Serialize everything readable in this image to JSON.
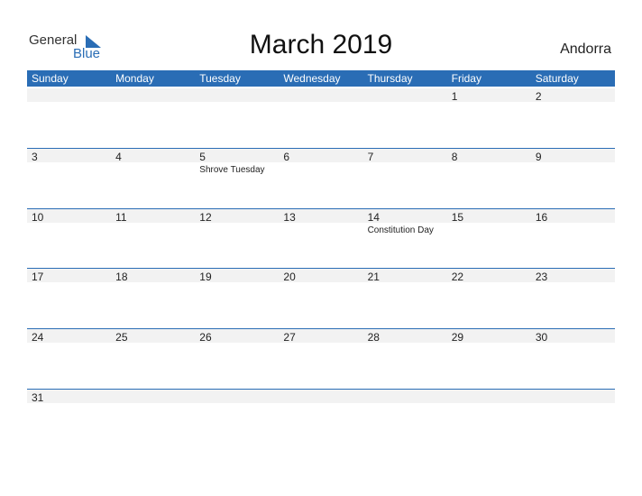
{
  "logo": {
    "general": "General",
    "blue": "Blue"
  },
  "title": "March 2019",
  "country": "Andorra",
  "colors": {
    "accent": "#2a6db5",
    "band": "#f2f2f2"
  },
  "weekdays": [
    "Sunday",
    "Monday",
    "Tuesday",
    "Wednesday",
    "Thursday",
    "Friday",
    "Saturday"
  ],
  "weeks": [
    [
      {
        "n": ""
      },
      {
        "n": ""
      },
      {
        "n": ""
      },
      {
        "n": ""
      },
      {
        "n": ""
      },
      {
        "n": "1"
      },
      {
        "n": "2"
      }
    ],
    [
      {
        "n": "3"
      },
      {
        "n": "4"
      },
      {
        "n": "5",
        "event": "Shrove Tuesday"
      },
      {
        "n": "6"
      },
      {
        "n": "7"
      },
      {
        "n": "8"
      },
      {
        "n": "9"
      }
    ],
    [
      {
        "n": "10"
      },
      {
        "n": "11"
      },
      {
        "n": "12"
      },
      {
        "n": "13"
      },
      {
        "n": "14",
        "event": "Constitution Day"
      },
      {
        "n": "15"
      },
      {
        "n": "16"
      }
    ],
    [
      {
        "n": "17"
      },
      {
        "n": "18"
      },
      {
        "n": "19"
      },
      {
        "n": "20"
      },
      {
        "n": "21"
      },
      {
        "n": "22"
      },
      {
        "n": "23"
      }
    ],
    [
      {
        "n": "24"
      },
      {
        "n": "25"
      },
      {
        "n": "26"
      },
      {
        "n": "27"
      },
      {
        "n": "28"
      },
      {
        "n": "29"
      },
      {
        "n": "30"
      }
    ],
    [
      {
        "n": "31"
      },
      {
        "n": ""
      },
      {
        "n": ""
      },
      {
        "n": ""
      },
      {
        "n": ""
      },
      {
        "n": ""
      },
      {
        "n": ""
      }
    ]
  ]
}
